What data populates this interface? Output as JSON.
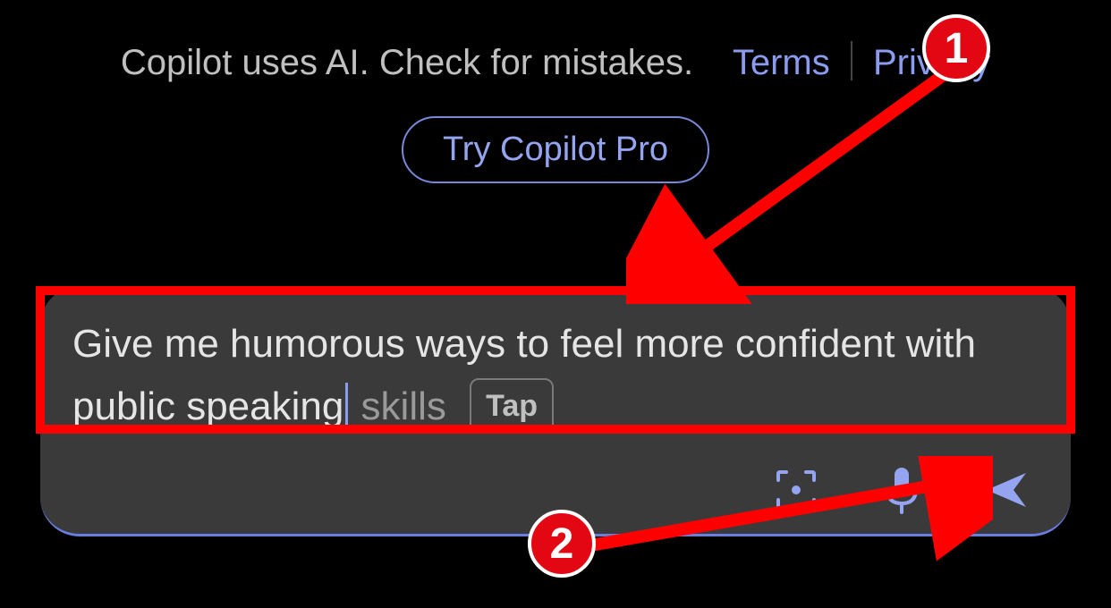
{
  "disclaimer": {
    "text": "Copilot uses AI. Check for mistakes.",
    "terms_label": "Terms",
    "privacy_label": "Privacy"
  },
  "pro_button_label": "Try Copilot Pro",
  "input": {
    "typed": "Give me humorous ways to feel more confident with public speaking",
    "suggestion": " skills",
    "tap_label": "Tap"
  },
  "annotations": {
    "badge1": "1",
    "badge2": "2"
  },
  "colors": {
    "accent": "#8a9cf0",
    "annotation": "#ff0000",
    "badge_bg": "#e30613"
  }
}
